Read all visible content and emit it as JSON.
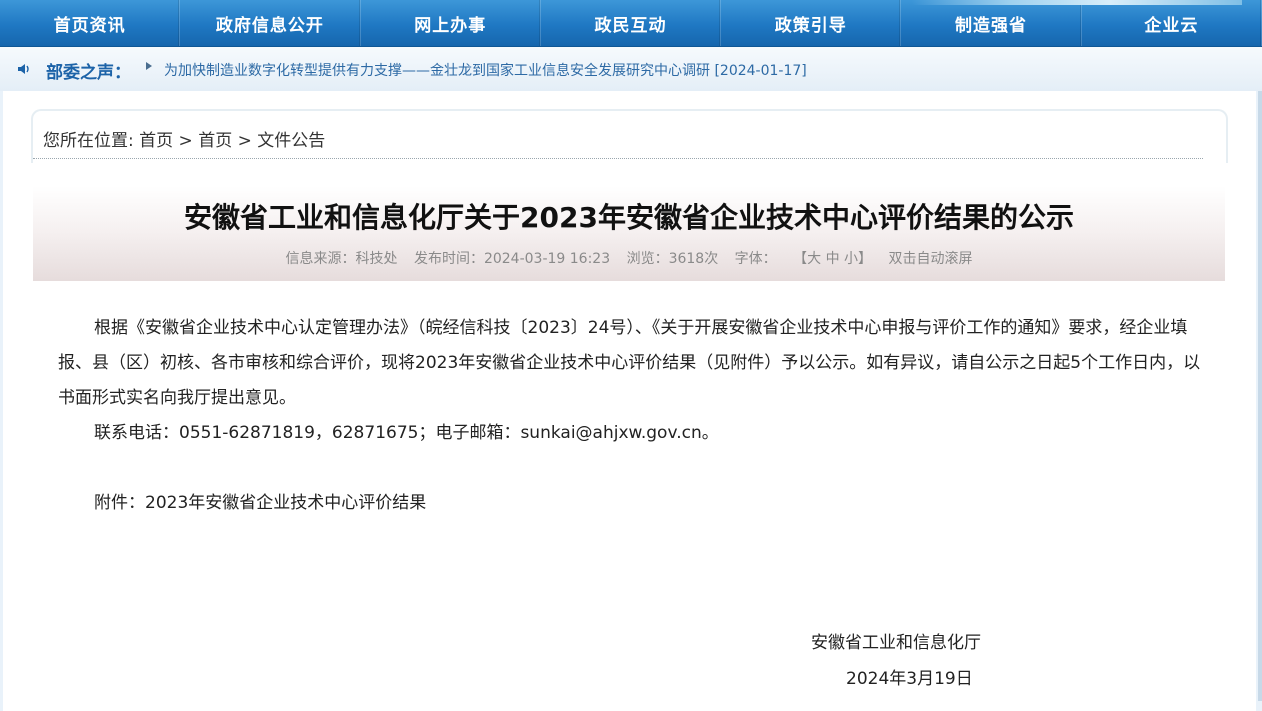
{
  "nav": {
    "items": [
      "首页资讯",
      "政府信息公开",
      "网上办事",
      "政民互动",
      "政策引导",
      "制造强省",
      "企业云"
    ]
  },
  "voice": {
    "title": "部委之声：",
    "headline": "为加快制造业数字化转型提供有力支撑——金壮龙到国家工业信息安全发展研究中心调研 [2024-01-17]"
  },
  "breadcrumb": {
    "prefix": "您所在位置:",
    "items": [
      "首页",
      "首页",
      "文件公告"
    ],
    "separator": ">"
  },
  "article": {
    "title": "安徽省工业和信息化厅关于2023年安徽省企业技术中心评价结果的公示",
    "meta": {
      "source": "信息来源：科技处",
      "published": "发布时间：2024-03-19 16:23",
      "views": "浏览：3618次",
      "font_label": "字体：",
      "font_sizes": "【大 中 小】",
      "autoscroll": "双击自动滚屏"
    },
    "paragraph1": "根据《安徽省企业技术中心认定管理办法》（皖经信科技〔2023〕24号）、《关于开展安徽省企业技术中心申报与评价工作的通知》要求，经企业填报、县（区）初核、各市审核和综合评价，现将2023年安徽省企业技术中心评价结果（见附件）予以公示。如有异议，请自公示之日起5个工作日内，以书面形式实名向我厅提出意见。",
    "contact": "联系电话：0551-62871819，62871675；电子邮箱：sunkai@ahjxw.gov.cn。",
    "attachment": "附件：2023年安徽省企业技术中心评价结果",
    "signature": "安徽省工业和信息化厅",
    "date": "2024年3月19日"
  }
}
